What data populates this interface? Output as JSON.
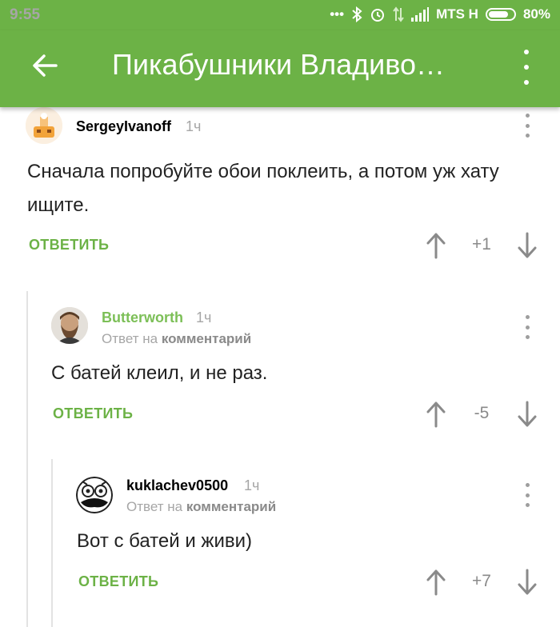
{
  "status": {
    "time": "9:55",
    "carrier": "MTS H",
    "battery_percent": "80%",
    "battery_level": 0.8,
    "icons": [
      "dots-icon",
      "bluetooth-icon",
      "alarm-icon",
      "data-icon",
      "signal-icon",
      "battery-icon"
    ]
  },
  "toolbar": {
    "title": "Пикабушники Владиво…",
    "back_icon": "back-arrow-icon",
    "menu_icon": "more-vert-icon"
  },
  "colors": {
    "accent": "#6cb246",
    "text": "#222222",
    "muted": "#a6a6a6"
  },
  "comments": [
    {
      "username": "SergeyIvanoff",
      "username_color": "#222222",
      "time": "1ч",
      "body": "Сначала попробуйте обои поклеить, а потом уж хату ищите.",
      "reply_label": "ОТВЕТИТЬ",
      "score": "+1"
    },
    {
      "username": "Butterworth",
      "username_color": "#7cbf57",
      "time": "1ч",
      "reply_to_prefix": "Ответ на",
      "reply_to_target": "комментарий",
      "body": "С батей клеил, и не раз.",
      "reply_label": "ОТВЕТИТЬ",
      "score": "-5"
    },
    {
      "username": "kuklachev0500",
      "username_color": "#222222",
      "time": "1ч",
      "reply_to_prefix": "Ответ на",
      "reply_to_target": "комментарий",
      "body": "Вот с батей и живи)",
      "reply_label": "ОТВЕТИТЬ",
      "score": "+7"
    }
  ]
}
